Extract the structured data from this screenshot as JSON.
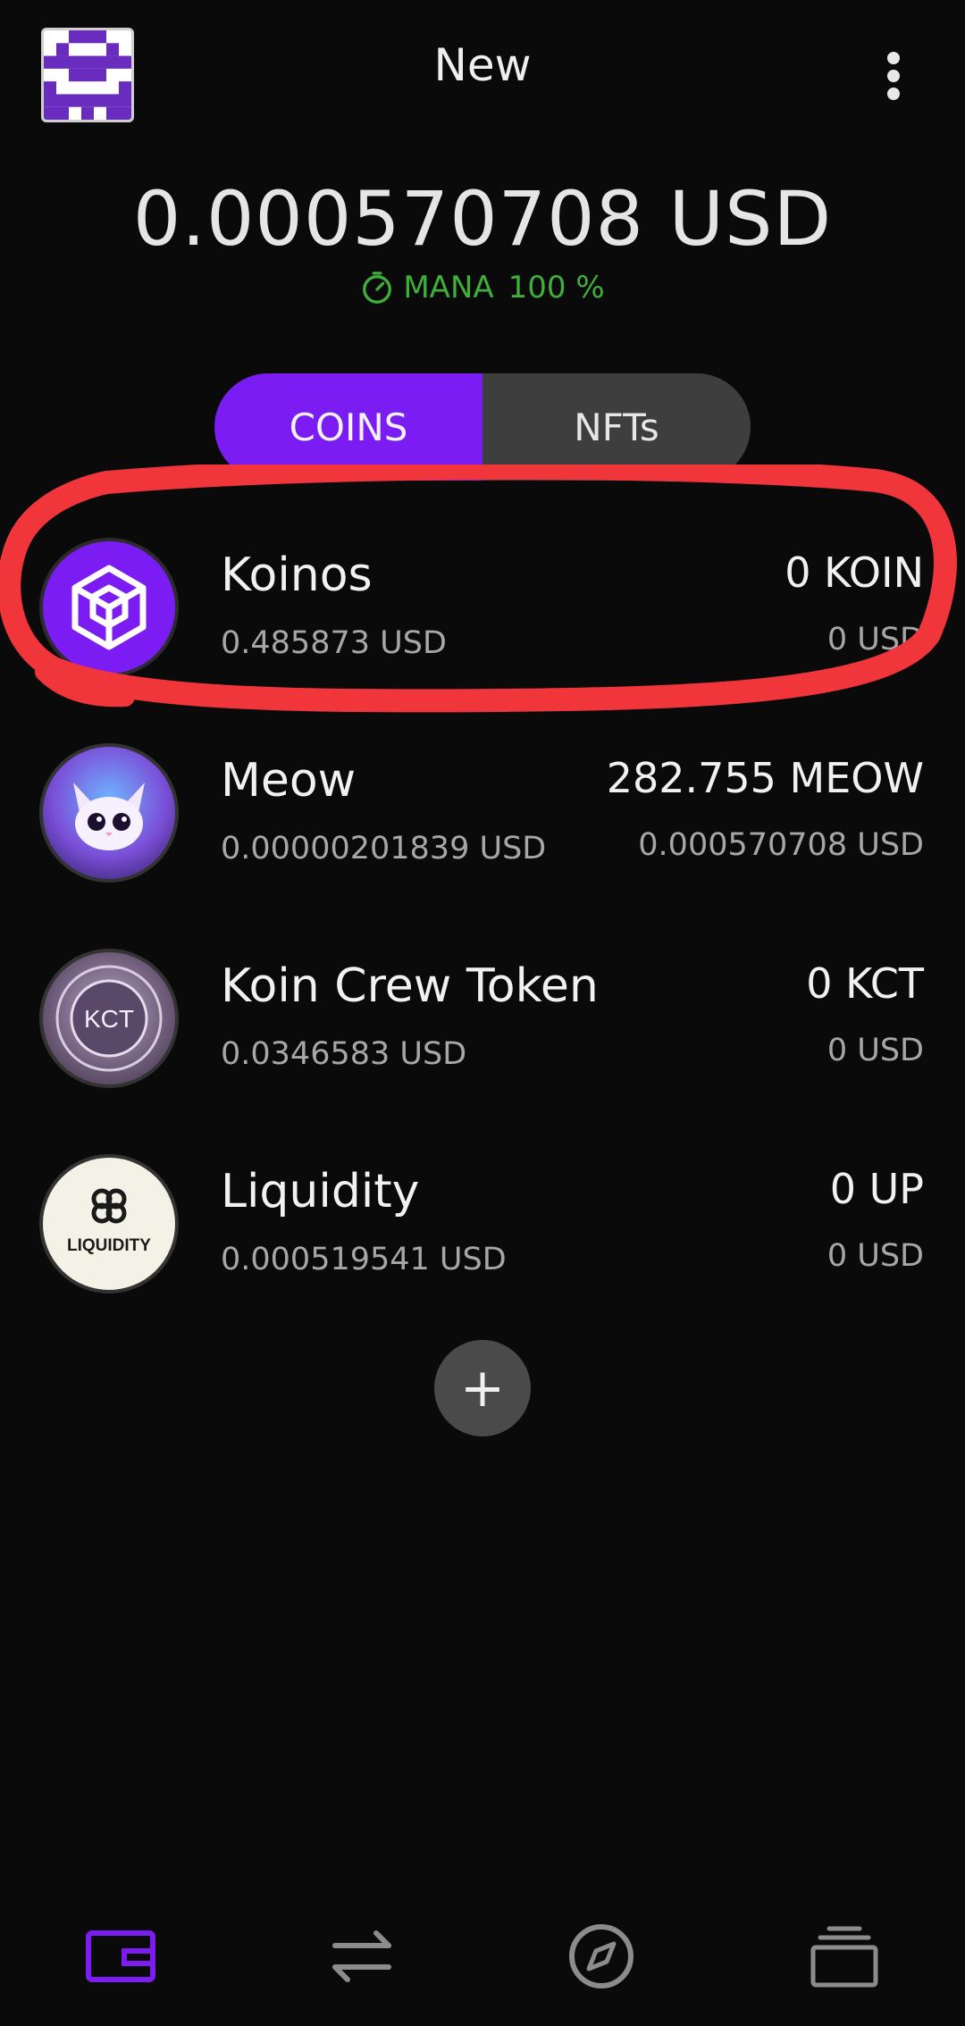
{
  "header": {
    "title": "New",
    "avatar_icon": "pixel-identicon",
    "menu_icon": "more-vertical-icon"
  },
  "balance": {
    "total": "0.000570708 USD",
    "mana_label": "MANA",
    "mana_value": "100 %"
  },
  "tabs": [
    {
      "label": "COINS",
      "active": true
    },
    {
      "label": "NFTs",
      "active": false
    }
  ],
  "coins": [
    {
      "name": "Koinos",
      "price": "0.485873 USD",
      "amount": "0 KOIN",
      "value": "0 USD",
      "icon": "koinos-cube-icon"
    },
    {
      "name": "Meow",
      "price": "0.00000201839 USD",
      "amount": "282.755 MEOW",
      "value": "0.000570708 USD",
      "icon": "meow-cat-icon"
    },
    {
      "name": "Koin Crew Token",
      "price": "0.0346583 USD",
      "amount": "0 KCT",
      "value": "0 USD",
      "icon": "kct-coin-icon",
      "icon_text": "KCT"
    },
    {
      "name": "Liquidity",
      "price": "0.000519541 USD",
      "amount": "0 UP",
      "value": "0 USD",
      "icon": "liquidity-icon",
      "icon_text": "LIQUIDITY"
    }
  ],
  "add_button": {
    "label": "+"
  },
  "nav": [
    {
      "name": "wallet",
      "icon": "wallet-icon",
      "active": true
    },
    {
      "name": "swap",
      "icon": "swap-icon",
      "active": false
    },
    {
      "name": "explore",
      "icon": "compass-icon",
      "active": false
    },
    {
      "name": "accounts",
      "icon": "stack-icon",
      "active": false
    }
  ],
  "colors": {
    "accent": "#7b1cf2",
    "mana_green": "#3fae3a",
    "annotation_red": "#f0363a",
    "background": "#0a0a0a"
  }
}
